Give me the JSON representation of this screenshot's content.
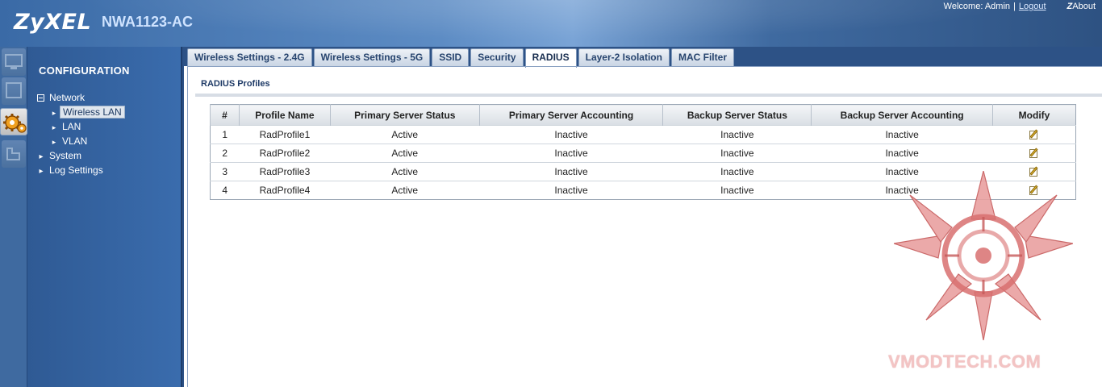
{
  "header": {
    "brand": "ZyXEL",
    "model": "NWA1123-AC",
    "welcome_label": "Welcome: Admin",
    "separator": "|",
    "logout_label": "Logout",
    "about_prefix": "Z",
    "about_label": "About"
  },
  "nav": {
    "title": "CONFIGURATION",
    "items": [
      {
        "label": "Network",
        "expanded": true
      },
      {
        "label": "Wireless LAN",
        "selected": true
      },
      {
        "label": "LAN"
      },
      {
        "label": "VLAN"
      },
      {
        "label": "System"
      },
      {
        "label": "Log Settings"
      }
    ]
  },
  "tabs": [
    {
      "label": "Wireless Settings - 2.4G"
    },
    {
      "label": "Wireless Settings - 5G"
    },
    {
      "label": "SSID"
    },
    {
      "label": "Security"
    },
    {
      "label": "RADIUS",
      "active": true
    },
    {
      "label": "Layer-2 Isolation"
    },
    {
      "label": "MAC Filter"
    }
  ],
  "section": {
    "title": "RADIUS Profiles"
  },
  "table": {
    "columns": [
      "#",
      "Profile Name",
      "Primary Server Status",
      "Primary Server Accounting",
      "Backup Server Status",
      "Backup Server Accounting",
      "Modify"
    ],
    "rows": [
      {
        "num": "1",
        "name": "RadProfile1",
        "primary_status": "Active",
        "primary_accounting": "Inactive",
        "backup_status": "Inactive",
        "backup_accounting": "Inactive"
      },
      {
        "num": "2",
        "name": "RadProfile2",
        "primary_status": "Active",
        "primary_accounting": "Inactive",
        "backup_status": "Inactive",
        "backup_accounting": "Inactive"
      },
      {
        "num": "3",
        "name": "RadProfile3",
        "primary_status": "Active",
        "primary_accounting": "Inactive",
        "backup_status": "Inactive",
        "backup_accounting": "Inactive"
      },
      {
        "num": "4",
        "name": "RadProfile4",
        "primary_status": "Active",
        "primary_accounting": "Inactive",
        "backup_status": "Inactive",
        "backup_accounting": "Inactive"
      }
    ]
  },
  "watermark": {
    "text": "VMODTECH.COM"
  },
  "colors": {
    "header_blue": "#3a6aa6",
    "nav_blue": "#2f5a94",
    "watermark_red": "#e06a6a"
  },
  "icons": {
    "modify": "edit-icon",
    "strip": [
      "monitor-icon",
      "configuration-icon",
      "maintenance-icon"
    ]
  }
}
